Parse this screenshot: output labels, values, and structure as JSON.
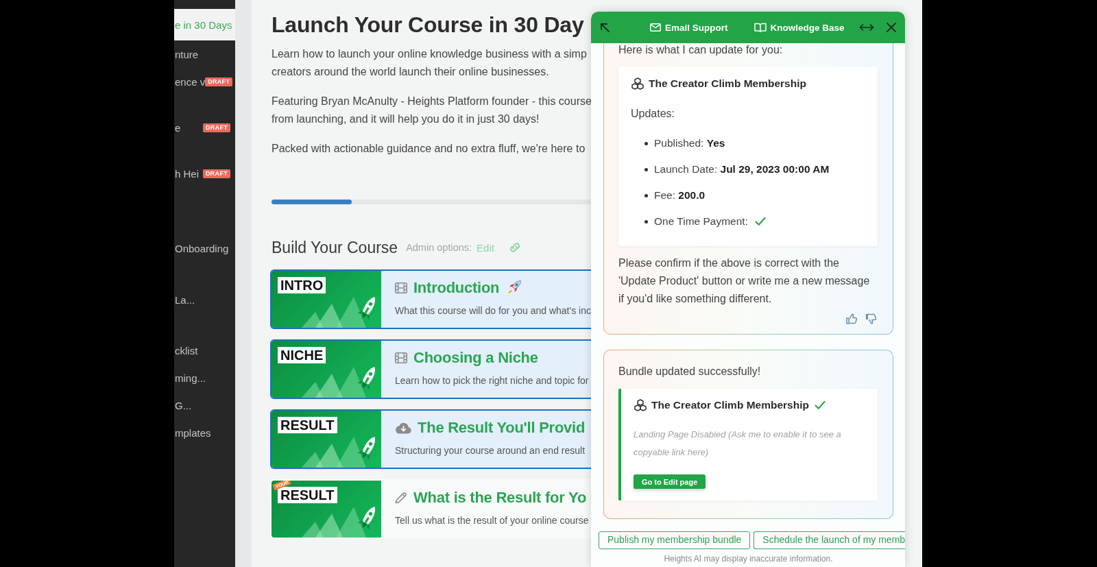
{
  "sidebar": {
    "items": [
      {
        "label": "e in 30 Days",
        "selected": true
      },
      {
        "label": "nture",
        "selected": false
      },
      {
        "label": "ence v",
        "selected": false,
        "badge": "DRAFT"
      },
      {
        "label": "e",
        "selected": false,
        "badge": "DRAFT"
      },
      {
        "label": "h Hei",
        "selected": false,
        "badge": "DRAFT"
      },
      {
        "label": "Onboarding",
        "selected": false
      },
      {
        "label": "La...",
        "selected": false
      },
      {
        "label": "cklist",
        "selected": false
      },
      {
        "label": "ming...",
        "selected": false
      },
      {
        "label": "G...",
        "selected": false
      },
      {
        "label": "mplates",
        "selected": false
      }
    ]
  },
  "course": {
    "title": "Launch Your Course in 30 Day",
    "paragraphs": [
      [
        "Learn how to launch your online knowledge business with a simp",
        "creators around the world launch their online businesses."
      ],
      [
        "Featuring Bryan McAnulty - Heights Platform founder - this course",
        "from launching, and it will help you do it in just 30 days!"
      ],
      [
        "Packed with actionable guidance and no extra fluff, we're here to"
      ]
    ],
    "progress": {
      "level": 0.25
    },
    "section": {
      "title": "Build Your Course",
      "admin_label": "Admin options:",
      "edit_link": "Edit"
    },
    "lessons": [
      {
        "tag": "INTRO",
        "kind": "video",
        "title": "Introduction",
        "emoji": true,
        "description": "What this course will do for you and what's inc",
        "highlighted": true
      },
      {
        "tag": "NICHE",
        "kind": "video",
        "title": "Choosing a Niche",
        "emoji": false,
        "description": "Learn how to pick the right niche and topic for",
        "highlighted": true
      },
      {
        "tag": "RESULT",
        "kind": "download",
        "title": "The Result You'll Provid",
        "emoji": false,
        "description": "Structuring your course around an end result",
        "highlighted": true
      },
      {
        "tag": "RESULT",
        "ribbon": "YOUR",
        "kind": "task",
        "title": "What is the Result for Yo",
        "emoji": false,
        "description": "Tell us what is the result of your online course",
        "highlighted": false
      }
    ]
  },
  "assistant": {
    "header": {
      "links": [
        "Email Support",
        "Knowledge Base"
      ]
    },
    "messages": [
      {
        "kind": "preview",
        "intro": "Here is what I can update for you:",
        "product": "The Creator Climb Membership",
        "success": false,
        "updates_label": "Updates:",
        "updates": [
          {
            "text": "Published: **Yes**",
            "checked": false
          },
          {
            "text": "Launch Date: **Jul 29, 2023 00:00 AM**",
            "checked": false
          },
          {
            "text": "Fee: **200.0**",
            "checked": false
          },
          {
            "text": "One Time Payment:",
            "checked": true
          }
        ],
        "text": "Please confirm if the above is correct with the 'Update Product' button or write me a new message if you'd like something different.",
        "feedback": true
      },
      {
        "kind": "result",
        "intro": "Bundle updated successfully!",
        "product": "The Creator Climb Membership",
        "success": true,
        "note": "Landing Page Disabled (Ask me to enable it to see a copyable link here)",
        "button": "Go to Edit page",
        "feedback": false
      }
    ],
    "suggestions": [
      "Publish my membership bundle",
      "Schedule the launch of my memb"
    ],
    "disclaimer": "Heights AI may display inaccurate information."
  }
}
